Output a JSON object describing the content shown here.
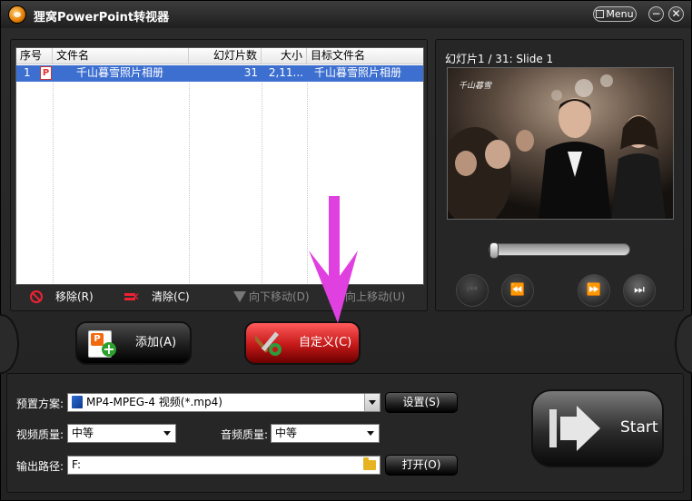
{
  "app": {
    "title": "狸窝PowerPoint转视器",
    "menu_label": "Menu",
    "minimize": "−",
    "close": "✕"
  },
  "file_table": {
    "columns": [
      "序号",
      "文件名",
      "幻灯片数",
      "大小",
      "目标文件名"
    ],
    "rows": [
      {
        "index": "1",
        "file_name": "千山暮雪照片相册",
        "slides": "31",
        "size": "2,11...",
        "target_name": "千山暮雪照片相册"
      }
    ]
  },
  "file_actions": {
    "remove": "移除(R)",
    "clear": "清除(C)",
    "move_down": "向下移动(D)",
    "move_up": "向上移动(U)"
  },
  "preview": {
    "label": "幻灯片1 / 31: Slide 1"
  },
  "buttons": {
    "add": "添加(A)",
    "custom": "自定义(C)",
    "settings": "设置(S)",
    "open": "打开(O)",
    "start": "Start"
  },
  "settings": {
    "preset_label": "预置方案:",
    "preset_value": "MP4-MPEG-4 视频(*.mp4)",
    "video_quality_label": "视频质量:",
    "video_quality_value": "中等",
    "audio_quality_label": "音频质量:",
    "audio_quality_value": "中等",
    "output_label": "输出路径:",
    "output_value": "F:"
  },
  "colors": {
    "selection": "#3d6fd0",
    "custom_button": "#c41818",
    "annotation_arrow": "#e040e0"
  }
}
